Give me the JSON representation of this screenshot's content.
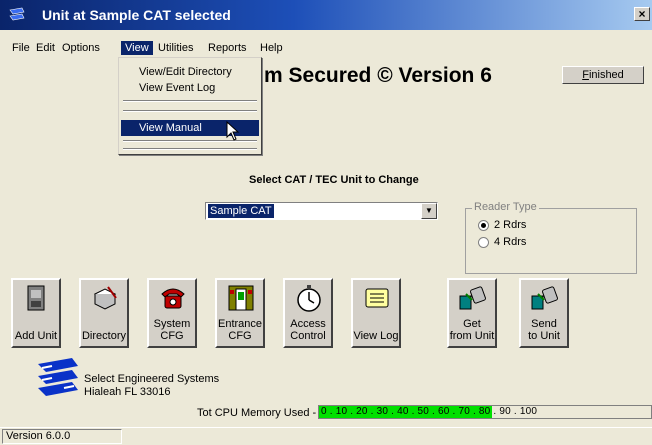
{
  "window": {
    "title": "Unit at Sample CAT selected",
    "close_label": "×"
  },
  "menubar": {
    "items": [
      "File",
      "Edit",
      "Options",
      "View",
      "Utilities",
      "Reports",
      "Help"
    ]
  },
  "view_menu": {
    "items": [
      "View/Edit  Directory",
      "View Event Log",
      "View Manual"
    ]
  },
  "heading": "m Secured © Version 6",
  "finished": {
    "first": "F",
    "rest": "inished"
  },
  "selector": {
    "label": "Select CAT / TEC Unit to Change",
    "value": "Sample CAT"
  },
  "reader_type": {
    "legend": "Reader Type",
    "options": [
      "2 Rdrs",
      "4 Rdrs"
    ]
  },
  "toolbar": {
    "add_unit": "Add Unit",
    "directory": "Directory",
    "system_cfg": [
      "System",
      "CFG"
    ],
    "entrance_cfg": [
      "Entrance",
      "CFG"
    ],
    "access_control": [
      "Access",
      "Control"
    ],
    "view_log": "View Log",
    "get_from_unit": [
      "Get",
      "from Unit"
    ],
    "send_to_unit": [
      "Send",
      "to Unit"
    ]
  },
  "company": {
    "name": "Select Engineered Systems",
    "address": "Hialeah FL 33016"
  },
  "cpu": {
    "label": "Tot CPU Memory Used - 52%",
    "percent": 52,
    "ticks": "0 . 10 . 20 . 30 . 40 . 50 . 60 . 70 . 80 . 90 . 100"
  },
  "status": {
    "version": "Version 6.0.0"
  },
  "colors": {
    "menu_highlight": "#0a246a",
    "meter_fill": "#00e000",
    "face": "#ece9d8"
  }
}
